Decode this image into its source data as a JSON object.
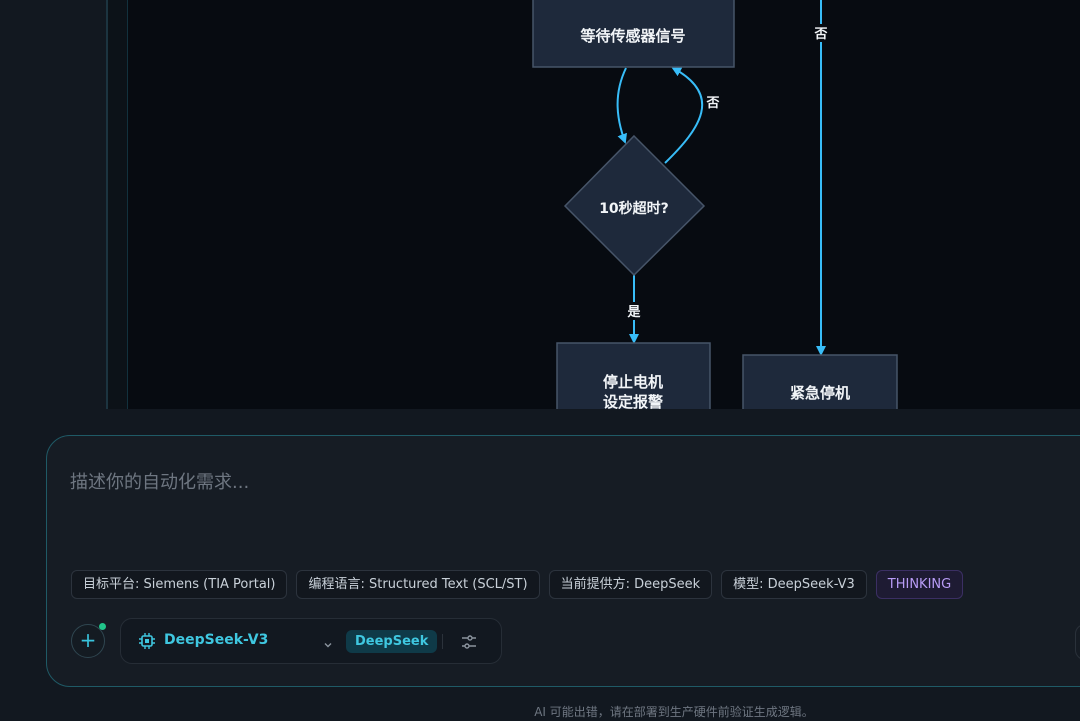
{
  "flowchart": {
    "nodes": {
      "wait_sensor": "等待传感器信号",
      "timeout_check": "10秒超时?",
      "stop_motor_line1": "停止电机",
      "stop_motor_line2": "设定报警",
      "emergency_stop": "紧急停机"
    },
    "edge_labels": {
      "no_top": "否",
      "no_loop": "否",
      "yes": "是"
    },
    "colors": {
      "node_fill": "#1e293b",
      "node_stroke": "#475569",
      "edge": "#38bdf8"
    }
  },
  "input": {
    "placeholder": "描述你的自动化需求...",
    "chips": [
      "目标平台: Siemens (TIA Portal)",
      "编程语言: Structured Text (SCL/ST)",
      "当前提供方: DeepSeek",
      "模型: DeepSeek-V3",
      "THINKING"
    ],
    "add_icon": "plus-icon",
    "model_selector": {
      "icon": "cpu-chip-icon",
      "model": "DeepSeek-V3",
      "provider": "DeepSeek",
      "settings_icon": "sliders-icon"
    }
  },
  "footer": {
    "disclaimer": "AI 可能出错，请在部署到生产硬件前验证生成逻辑。"
  },
  "colors": {
    "accent": "#3fc7e0",
    "thinking": "#b89cf6",
    "online_dot": "#21c48a"
  }
}
